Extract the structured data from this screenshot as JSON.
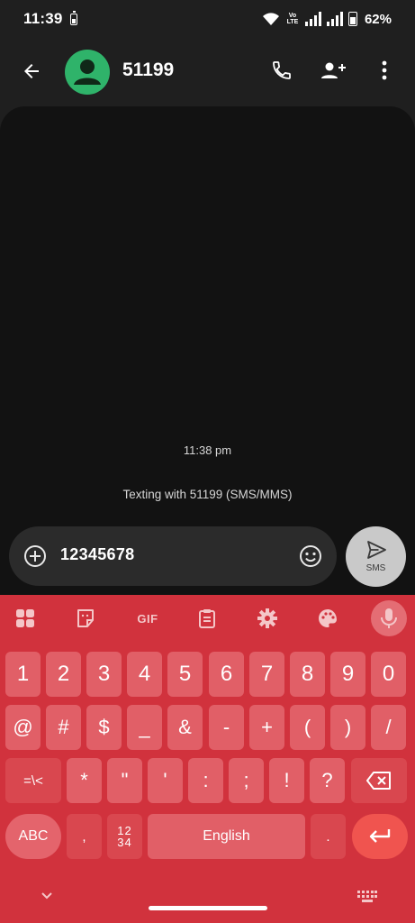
{
  "status_bar": {
    "time": "11:39",
    "volte": "Vo LTE",
    "battery_percent": "62%"
  },
  "header": {
    "contact_name": "51199",
    "avatar_color": "#2fb36a"
  },
  "conversation": {
    "timestamp": "11:38 pm",
    "info": "Texting with 51199 (SMS/MMS)"
  },
  "compose": {
    "text": "12345678",
    "send_label": "SMS"
  },
  "keyboard": {
    "toolbar": {
      "gif_label": "GIF"
    },
    "row1": [
      "1",
      "2",
      "3",
      "4",
      "5",
      "6",
      "7",
      "8",
      "9",
      "0"
    ],
    "row2": [
      "@",
      "#",
      "$",
      "_",
      "&",
      "-",
      "+",
      "(",
      ")",
      "/"
    ],
    "row3": [
      "=\\<",
      "*",
      "\"",
      "'",
      ":",
      ";",
      "!",
      "?"
    ],
    "row4": {
      "abc": "ABC",
      "comma": ",",
      "numpad_top": "12",
      "numpad_bottom": "34",
      "space": "English",
      "period": "."
    },
    "accent_color": "#d1323d"
  }
}
